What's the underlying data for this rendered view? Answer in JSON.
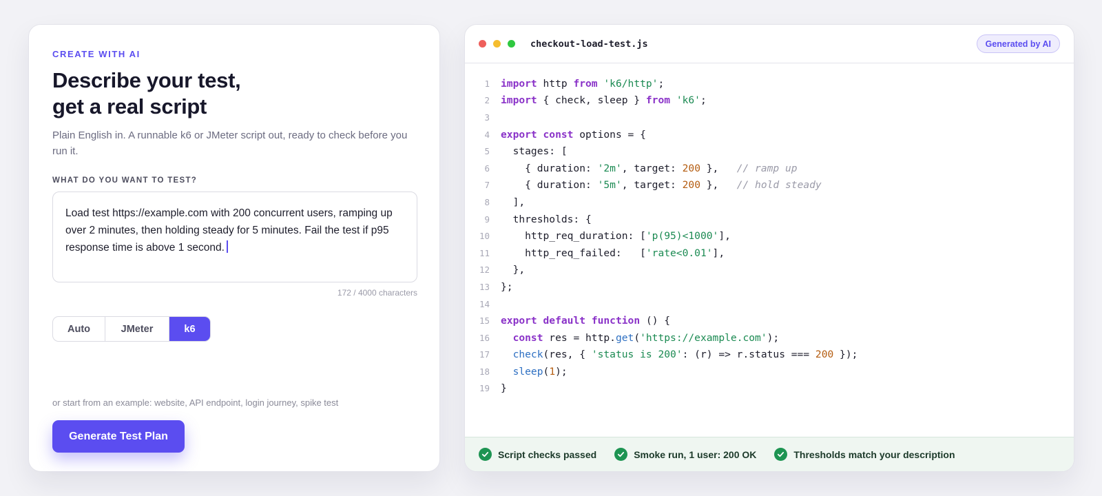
{
  "left": {
    "eyebrow": "CREATE WITH AI",
    "title_line1": "Describe your test,",
    "title_line2": "get a real script",
    "subtitle": "Plain English in. A runnable k6 or JMeter script out, ready to check before you run it.",
    "field_label": "WHAT DO YOU WANT TO TEST?",
    "prompt_text": "Load test https://example.com with 200 concurrent users, ramping up over 2 minutes, then holding steady for 5 minutes. Fail the test if p95 response time is above 1 second.",
    "char_count": "172 / 4000 characters",
    "formats": [
      {
        "label": "Auto",
        "active": false
      },
      {
        "label": "JMeter",
        "active": false
      },
      {
        "label": "k6",
        "active": true
      }
    ],
    "examples_text": "or start from an example: website, API endpoint, login journey, spike test",
    "generate_label": "Generate Test Plan"
  },
  "editor": {
    "filename": "checkout-load-test.js",
    "badge": "Generated by AI",
    "window_dot_colors": [
      "#ee5f5b",
      "#f5bd2f",
      "#2fc840"
    ],
    "line_numbers": [
      "1",
      "2",
      "3",
      "4",
      "5",
      "6",
      "7",
      "8",
      "9",
      "10",
      "11",
      "12",
      "13",
      "14",
      "15",
      "16",
      "17",
      "18",
      "19"
    ],
    "code": {
      "l1": [
        "import",
        " http ",
        "from",
        " ",
        "'k6/http'",
        ";"
      ],
      "l2": [
        "import",
        " { check, sleep } ",
        "from",
        " ",
        "'k6'",
        ";"
      ],
      "l4": [
        "export",
        " ",
        "const",
        " options = {"
      ],
      "l5": [
        "  stages: ["
      ],
      "l6": [
        "    { duration: ",
        "'2m'",
        ", target: ",
        "200",
        " },   ",
        "// ramp up"
      ],
      "l7": [
        "    { duration: ",
        "'5m'",
        ", target: ",
        "200",
        " },   ",
        "// hold steady"
      ],
      "l8": [
        "  ],"
      ],
      "l9": [
        "  thresholds: {"
      ],
      "l10": [
        "    http_req_duration: [",
        "'p(95)<1000'",
        "],"
      ],
      "l11": [
        "    http_req_failed:   [",
        "'rate<0.01'",
        "],"
      ],
      "l12": [
        "  },"
      ],
      "l13": [
        "};"
      ],
      "l15": [
        "export",
        " ",
        "default",
        " ",
        "function",
        " () {"
      ],
      "l16": [
        "  ",
        "const",
        " res = http.",
        "get",
        "(",
        "'https://example.com'",
        ");"
      ],
      "l17": [
        "  ",
        "check",
        "(res, { ",
        "'status is 200'",
        ": (r) => r.status === ",
        "200",
        " });"
      ],
      "l18": [
        "  ",
        "sleep",
        "(",
        "1",
        ");"
      ],
      "l19": [
        "}"
      ]
    }
  },
  "footer": {
    "checks": [
      "Script checks passed",
      "Smoke run, 1 user: 200 OK",
      "Thresholds match your description"
    ],
    "check_icon": "check-circle-icon"
  },
  "colors": {
    "accent": "#5b4df0",
    "success": "#1d9452"
  }
}
